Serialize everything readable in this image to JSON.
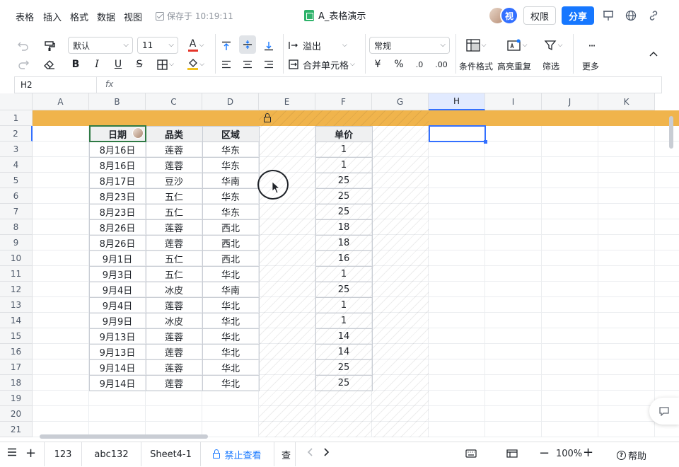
{
  "menu": {
    "items": [
      "表格",
      "插入",
      "格式",
      "数据",
      "视图"
    ],
    "save_status": "保存于 10:19:11"
  },
  "doc": {
    "title": "A_表格演示"
  },
  "header": {
    "avatar2_text": "视",
    "permission_label": "权限",
    "share_label": "分享"
  },
  "toolbar": {
    "font_name": "默认",
    "font_size": "11",
    "font_color_glyph": "A",
    "overflow_label": "溢出",
    "merge_label": "合并单元格",
    "number_format": "常规",
    "currency_glyph": "¥",
    "percent_glyph": "%",
    "decrease_decimal": ".0",
    "increase_decimal": ".00",
    "conditional_format_label": "条件格式",
    "highlight_dup_label": "高亮重复",
    "filter_label": "筛选",
    "more_label": "更多",
    "more_dots": "···"
  },
  "formula": {
    "cell_ref": "H2",
    "fx": "fx"
  },
  "grid": {
    "columns": [
      "A",
      "B",
      "C",
      "D",
      "E",
      "F",
      "G",
      "H",
      "I",
      "J",
      "K"
    ],
    "rows": [
      "1",
      "2",
      "3",
      "4",
      "5",
      "6",
      "7",
      "8",
      "9",
      "10",
      "11",
      "12",
      "13",
      "14",
      "15",
      "16",
      "17",
      "18",
      "19",
      "20",
      "21"
    ]
  },
  "table": {
    "headers": {
      "date": "日期",
      "category": "品类",
      "region": "区域",
      "price": "单价"
    },
    "rows": [
      {
        "date": "8月16日",
        "category": "莲蓉",
        "region": "华东",
        "price": "1"
      },
      {
        "date": "8月16日",
        "category": "莲蓉",
        "region": "华东",
        "price": "1"
      },
      {
        "date": "8月17日",
        "category": "豆沙",
        "region": "华南",
        "price": "25"
      },
      {
        "date": "8月23日",
        "category": "五仁",
        "region": "华东",
        "price": "25"
      },
      {
        "date": "8月23日",
        "category": "五仁",
        "region": "华东",
        "price": "25"
      },
      {
        "date": "8月26日",
        "category": "莲蓉",
        "region": "西北",
        "price": "18"
      },
      {
        "date": "8月26日",
        "category": "莲蓉",
        "region": "西北",
        "price": "18"
      },
      {
        "date": "9月1日",
        "category": "五仁",
        "region": "西北",
        "price": "16"
      },
      {
        "date": "9月3日",
        "category": "五仁",
        "region": "华北",
        "price": "1"
      },
      {
        "date": "9月4日",
        "category": "冰皮",
        "region": "华南",
        "price": "25"
      },
      {
        "date": "9月4日",
        "category": "莲蓉",
        "region": "华北",
        "price": "1"
      },
      {
        "date": "9月9日",
        "category": "冰皮",
        "region": "华北",
        "price": "1"
      },
      {
        "date": "9月13日",
        "category": "莲蓉",
        "region": "华北",
        "price": "14"
      },
      {
        "date": "9月13日",
        "category": "莲蓉",
        "region": "华北",
        "price": "14"
      },
      {
        "date": "9月14日",
        "category": "莲蓉",
        "region": "华北",
        "price": "25"
      },
      {
        "date": "9月14日",
        "category": "莲蓉",
        "region": "华北",
        "price": "25"
      }
    ]
  },
  "tabs": {
    "items": [
      "123",
      "abc132",
      "Sheet4-1",
      "禁止查看",
      "查"
    ],
    "active": "禁止查看"
  },
  "statusbar": {
    "zoom": "100%",
    "help_label": "帮助"
  },
  "colors": {
    "accent": "#1677ff",
    "band": "#f0b44c",
    "selection": "#3370ff",
    "cell_selection": "#2f7a44"
  }
}
